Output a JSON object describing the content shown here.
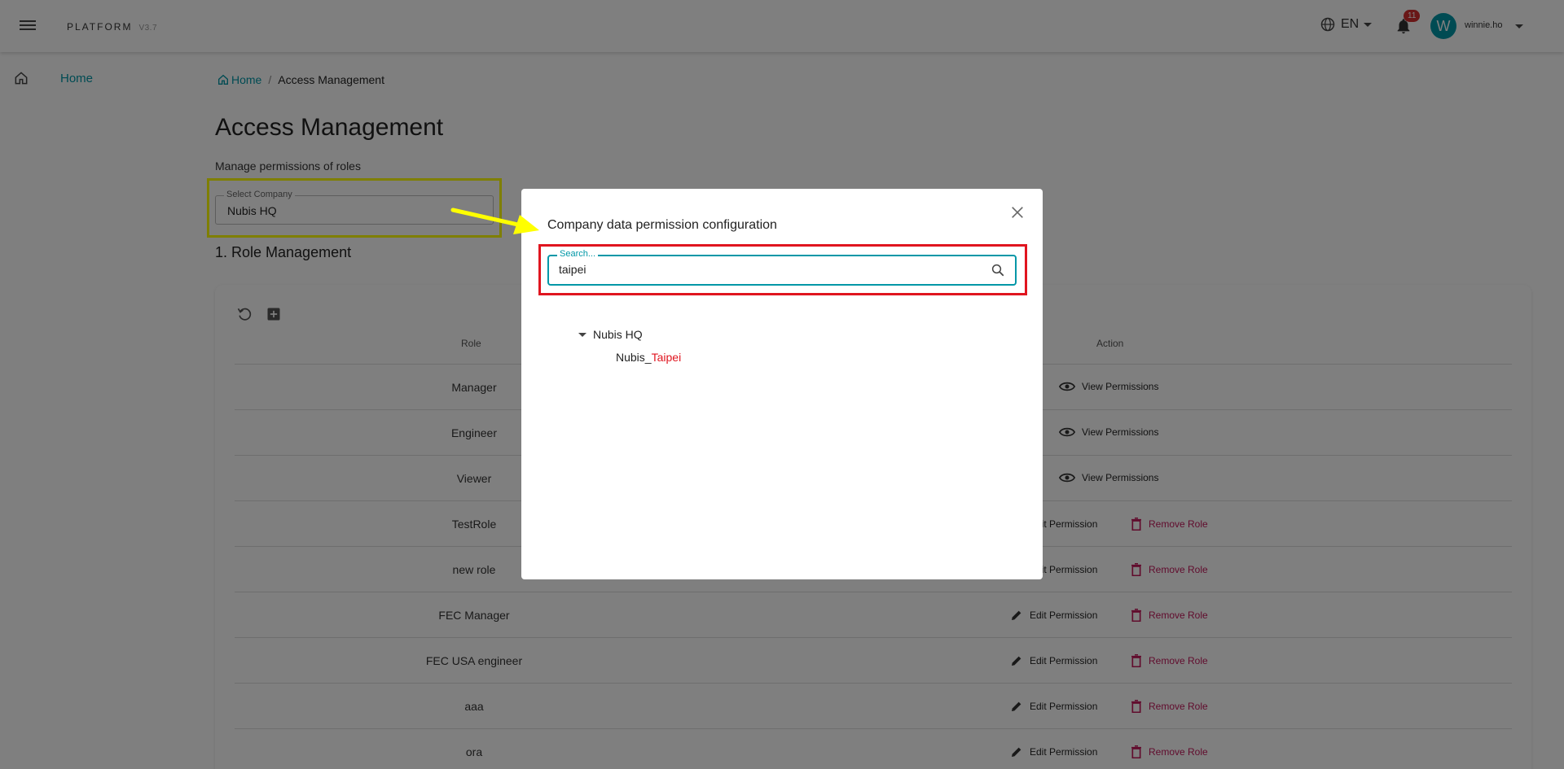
{
  "header": {
    "brand": "PLATFORM",
    "version": "V3.7",
    "language": "EN",
    "notifications": "11",
    "avatar_letter": "W",
    "username": "winnie.ho"
  },
  "sidebar": {
    "items": [
      {
        "label": "Home",
        "icon": "home-icon"
      }
    ]
  },
  "breadcrumb": {
    "home": "Home",
    "current": "Access Management"
  },
  "page": {
    "title": "Access Management",
    "subtitle": "Manage permissions of roles",
    "company_label": "Select Company",
    "company_value": "Nubis HQ",
    "section_title": "1. Role Management"
  },
  "table": {
    "headers": {
      "role": "Role",
      "action": "Action"
    },
    "rows": [
      {
        "role": "Manager",
        "actions": [
          "View Permissions"
        ]
      },
      {
        "role": "Engineer",
        "actions": [
          "View Permissions"
        ]
      },
      {
        "role": "Viewer",
        "actions": [
          "View Permissions"
        ]
      },
      {
        "role": "TestRole",
        "actions": [
          "Edit Permission",
          "Remove Role"
        ]
      },
      {
        "role": "new role",
        "actions": [
          "Edit Permission",
          "Remove Role"
        ]
      },
      {
        "role": "FEC Manager",
        "actions": [
          "Edit Permission",
          "Remove Role"
        ]
      },
      {
        "role": "FEC USA engineer",
        "actions": [
          "Edit Permission",
          "Remove Role"
        ]
      },
      {
        "role": "aaa",
        "actions": [
          "Edit Permission",
          "Remove Role"
        ]
      },
      {
        "role": "ora",
        "actions": [
          "Edit Permission",
          "Remove Role"
        ]
      }
    ]
  },
  "dialog": {
    "title": "Company data permission configuration",
    "search_label": "Search...",
    "search_value": "taipei",
    "tree": {
      "root": "Nubis HQ",
      "child_prefix": "Nubis_",
      "child_match": "Taipei"
    }
  },
  "colors": {
    "accent": "#0097a7",
    "remove": "#c2185b",
    "highlight_yellow": "#ffff00",
    "highlight_red": "#e0151f",
    "badge": "#d32f2f"
  }
}
